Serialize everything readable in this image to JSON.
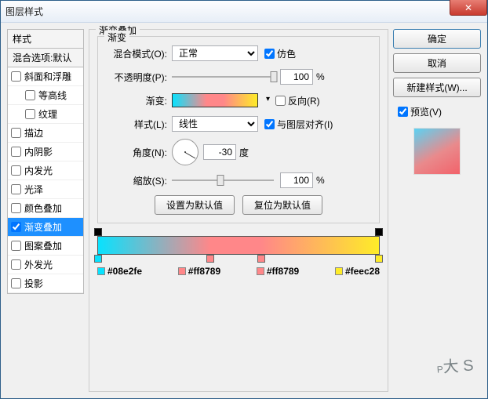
{
  "window": {
    "title": "图层样式"
  },
  "sidebar": {
    "header1": "样式",
    "header2": "混合选项:默认",
    "items": [
      {
        "label": "斜面和浮雕",
        "checked": false,
        "selected": false,
        "indent": false
      },
      {
        "label": "等高线",
        "checked": false,
        "selected": false,
        "indent": true
      },
      {
        "label": "纹理",
        "checked": false,
        "selected": false,
        "indent": true
      },
      {
        "label": "描边",
        "checked": false,
        "selected": false,
        "indent": false
      },
      {
        "label": "内阴影",
        "checked": false,
        "selected": false,
        "indent": false
      },
      {
        "label": "内发光",
        "checked": false,
        "selected": false,
        "indent": false
      },
      {
        "label": "光泽",
        "checked": false,
        "selected": false,
        "indent": false
      },
      {
        "label": "颜色叠加",
        "checked": false,
        "selected": false,
        "indent": false
      },
      {
        "label": "渐变叠加",
        "checked": true,
        "selected": true,
        "indent": false
      },
      {
        "label": "图案叠加",
        "checked": false,
        "selected": false,
        "indent": false
      },
      {
        "label": "外发光",
        "checked": false,
        "selected": false,
        "indent": false
      },
      {
        "label": "投影",
        "checked": false,
        "selected": false,
        "indent": false
      }
    ]
  },
  "main": {
    "section_title": "渐变叠加",
    "sub_title": "渐变",
    "blend_mode_label": "混合模式(O):",
    "blend_mode_value": "正常",
    "dither_label": "仿色",
    "dither_checked": true,
    "opacity_label": "不透明度(P):",
    "opacity_value": "100",
    "opacity_unit": "%",
    "gradient_label": "渐变:",
    "reverse_label": "反向(R)",
    "reverse_checked": false,
    "style_label": "样式(L):",
    "style_value": "线性",
    "align_label": "与图层对齐(I)",
    "align_checked": true,
    "angle_label": "角度(N):",
    "angle_value": "-30",
    "angle_unit": "度",
    "scale_label": "缩放(S):",
    "scale_value": "100",
    "scale_unit": "%",
    "set_default": "设置为默认值",
    "reset_default": "复位为默认值"
  },
  "gradient": {
    "opacity_stops": [
      0,
      100
    ],
    "color_stops": [
      {
        "pos": 0,
        "hex": "#08e2fe"
      },
      {
        "pos": 40,
        "hex": "#ff8789"
      },
      {
        "pos": 58,
        "hex": "#ff8789"
      },
      {
        "pos": 100,
        "hex": "#feec28"
      }
    ]
  },
  "buttons": {
    "ok": "确定",
    "cancel": "取消",
    "new_style": "新建样式(W)...",
    "preview_label": "预览(V)",
    "preview_checked": true
  },
  "watermark": {
    "main": "P",
    "sub": "大 S"
  }
}
